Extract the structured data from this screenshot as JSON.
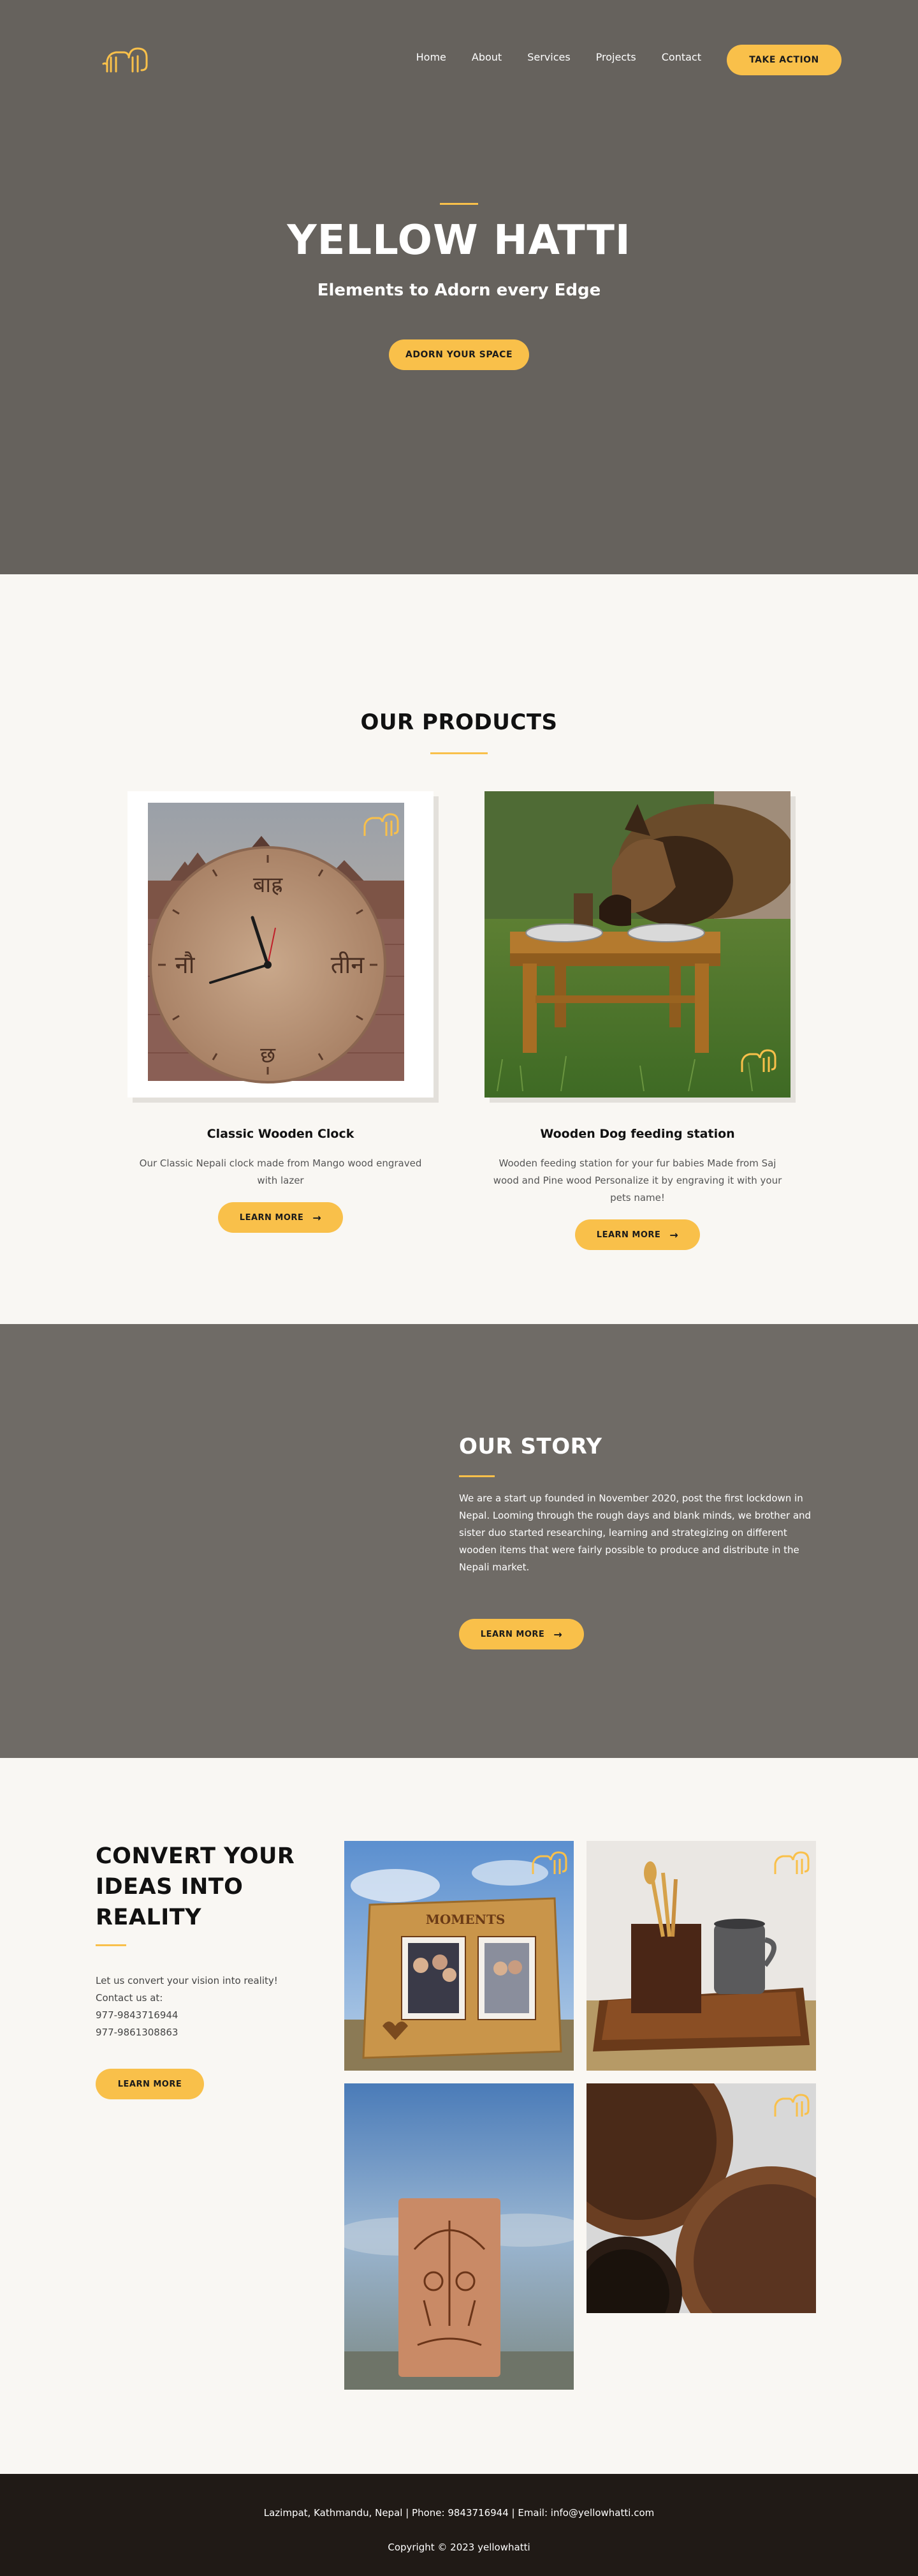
{
  "colors": {
    "accent": "#f9c04a",
    "hero_bg": "#66625d",
    "story_bg": "#6f6b66",
    "page_bg": "#f9f7f3",
    "footer_bg": "#201a16"
  },
  "nav": {
    "logo_icon": "elephant-logo-icon",
    "links": [
      "Home",
      "About",
      "Services",
      "Projects",
      "Contact"
    ],
    "cta": "TAKE ACTION"
  },
  "hero": {
    "title": "YELLOW HATTI",
    "subtitle": "Elements to Adorn every Edge",
    "button": "ADORN YOUR SPACE"
  },
  "products": {
    "title": "OUR PRODUCTS",
    "items": [
      {
        "name": "Classic Wooden Clock",
        "description": "Our Classic Nepali clock made from Mango wood engraved with lazer",
        "button": "LEARN MORE",
        "clock_labels": {
          "top": "बाह्र",
          "left": "नौ",
          "right": "तीन",
          "bottom": "छ"
        }
      },
      {
        "name": "Wooden Dog feeding station",
        "description": "Wooden feeding station for your fur babies Made from Saj wood and Pine wood Personalize it by engraving it with your pets name!",
        "button": "LEARN MORE"
      }
    ]
  },
  "story": {
    "title": "OUR STORY",
    "text": "We are a start up founded in November 2020, post the first lockdown in Nepal. Looming through the rough days and blank minds, we brother and sister duo started researching, learning and strategizing on different wooden items that were fairly possible to produce and distribute in the Nepali market.",
    "button": "LEARN MORE"
  },
  "convert": {
    "title": "CONVERT YOUR IDEAS INTO REALITY",
    "lines": [
      "Let us convert your vision into reality!",
      "Contact us at:",
      "977-9843716944",
      "977-9861308863"
    ],
    "button": "LEARN MORE",
    "frame_label": "MOMENTS"
  },
  "footer": {
    "contact": "Lazimpat, Kathmandu, Nepal | Phone: 9843716944 | Email: info@yellowhatti.com",
    "copyright": "Copyright © 2023 yellowhatti"
  }
}
